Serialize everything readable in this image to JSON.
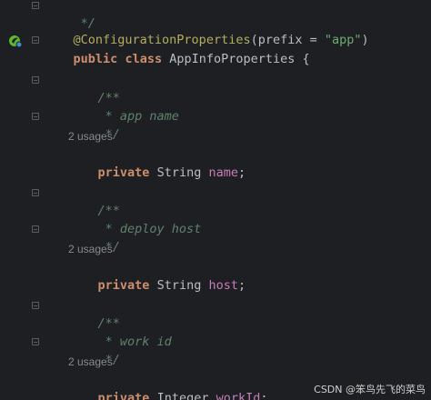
{
  "code": {
    "line_comment_close": " */",
    "annotation": {
      "at_name": "@ConfigurationProperties",
      "lparen": "(",
      "param": "prefix",
      "eq": " = ",
      "value": "\"app\"",
      "rparen": ")"
    },
    "class_decl": {
      "kw_public": "public",
      "kw_class": "class",
      "name": "AppInfoProperties",
      "brace": " {"
    },
    "fields": [
      {
        "doc_open": "/**",
        "doc_text": " * app name",
        "doc_close": " */",
        "usages": "2 usages",
        "modifier": "private",
        "type": "String",
        "name": "name",
        "semicolon": ";"
      },
      {
        "doc_open": "/**",
        "doc_text": " * deploy host",
        "doc_close": " */",
        "usages": "2 usages",
        "modifier": "private",
        "type": "String",
        "name": "host",
        "semicolon": ";"
      },
      {
        "doc_open": "/**",
        "doc_text": " * work id",
        "doc_close": " */",
        "usages": "2 usages",
        "modifier": "private",
        "type": "Integer",
        "name": "workId",
        "semicolon": ";"
      }
    ]
  },
  "watermark": "CSDN @笨鸟先飞的菜鸟",
  "colors": {
    "background": "#1e1f22",
    "keyword": "#cf8e6d",
    "annotation": "#b3ae60",
    "field": "#c77dbb",
    "string": "#6aab73",
    "comment": "#5f826b",
    "text": "#bcbec4",
    "usages": "#868a91"
  },
  "icons": {
    "gutter_spring_bean": "spring-bean-gutter-icon",
    "fold_markers": "fold-marker-icon"
  }
}
